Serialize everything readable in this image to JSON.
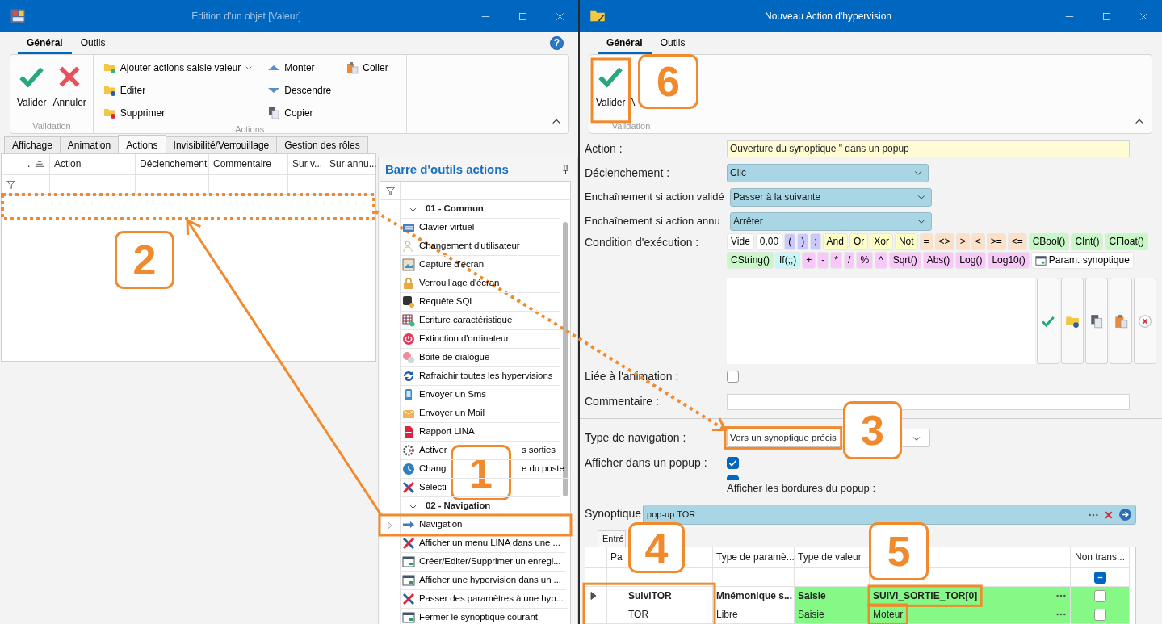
{
  "left_window": {
    "title": "Edition d'un objet [Valeur]",
    "active": false,
    "ribbon_tabs": [
      {
        "label": "Général",
        "selected": true
      },
      {
        "label": "Outils",
        "selected": false
      }
    ],
    "help": "?",
    "ribbon_groups": [
      {
        "kind": "large",
        "caption": "Validation",
        "buttons": [
          {
            "label": "Valider"
          },
          {
            "label": "Annuler"
          }
        ]
      },
      {
        "kind": "small",
        "caption": "Actions",
        "columns": [
          [
            {
              "label": "Ajouter actions saisie valeur",
              "dropdown": true
            },
            {
              "label": "Editer"
            },
            {
              "label": "Supprimer"
            }
          ],
          [
            {
              "label": "Monter"
            },
            {
              "label": "Descendre"
            },
            {
              "label": "Copier"
            }
          ],
          [
            {
              "label": "Coller"
            }
          ]
        ]
      }
    ],
    "tabs": [
      {
        "label": "Affichage",
        "selected": false
      },
      {
        "label": "Animation",
        "selected": false
      },
      {
        "label": "Actions",
        "selected": true
      },
      {
        "label": "Invisibilité/Verrouillage",
        "selected": false
      },
      {
        "label": "Gestion des rôles",
        "selected": false
      }
    ],
    "grid": {
      "columns": [
        {
          "label": ".",
          "sorted": true
        },
        {
          "label": "Action",
          "sorted": false
        },
        {
          "label": "Déclenchement",
          "sorted": false
        },
        {
          "label": "Commentaire",
          "sorted": false
        },
        {
          "label": "Sur v...",
          "sorted": false
        },
        {
          "label": "Sur annu...",
          "sorted": false
        }
      ]
    },
    "toolbox": {
      "title": "Barre d'outils actions",
      "groups": [
        {
          "label": "01 - Commun",
          "expanded": true,
          "children": [
            {
              "label": "Clavier virtuel",
              "selected": false
            },
            {
              "label": "Changement d'utilisateur",
              "selected": false
            },
            {
              "label": "Capture d'écran",
              "selected": false
            },
            {
              "label": "Verrouillage d'écran",
              "selected": false
            },
            {
              "label": "Requête SQL",
              "selected": false
            },
            {
              "label": "Ecriture caractéristique",
              "selected": false
            },
            {
              "label": "Extinction d'ordinateur",
              "selected": false
            },
            {
              "label": "Boite de dialogue",
              "selected": false
            },
            {
              "label": "Rafraichir toutes les hypervisions",
              "selected": false
            },
            {
              "label": "Envoyer un Sms",
              "selected": false
            },
            {
              "label": "Envoyer un Mail",
              "selected": false
            },
            {
              "label": "Rapport LINA",
              "selected": false
            },
            {
              "label": "Activer",
              "tail": "s sorties",
              "selected": false
            },
            {
              "label": "Chang",
              "tail": "e du poste",
              "selected": false
            },
            {
              "label": "Sélecti",
              "selected": false
            }
          ]
        },
        {
          "label": "02 - Navigation",
          "expanded": true,
          "children": [
            {
              "label": "Navigation",
              "selected": true
            },
            {
              "label": "Afficher un menu LINA dans une ...",
              "selected": false
            },
            {
              "label": "Créer/Editer/Supprimer un enregi...",
              "selected": false
            },
            {
              "label": "Afficher une hypervision dans un ...",
              "selected": false
            },
            {
              "label": "Passer des paramètres à une hyp...",
              "selected": false
            },
            {
              "label": "Fermer le synoptique courant",
              "selected": false
            }
          ]
        }
      ]
    }
  },
  "right_window": {
    "title": "Nouveau Action d'hypervision",
    "active": true,
    "ribbon_tabs": [
      {
        "label": "Général",
        "selected": true
      },
      {
        "label": "Outils",
        "selected": false
      }
    ],
    "ribbon_caption": "Validation",
    "ribbon_buttons": [
      {
        "label": "Valider"
      },
      {
        "label": "A"
      }
    ],
    "form": [
      {
        "label": "Action :",
        "kind": "text",
        "value": "Ouverture du synoptique \" dans un popup"
      },
      {
        "label": "Déclenchement :",
        "kind": "select",
        "value": "Clic"
      },
      {
        "label": "Enchaînement si action validé",
        "kind": "select",
        "value": "Passer à la suivante"
      },
      {
        "label": "Enchaînement si action annu",
        "kind": "select",
        "value": "Arrêter"
      },
      {
        "label": "Condition d'exécution :",
        "kind": "expression",
        "token_rows": [
          [
            {
              "label": "Vide",
              "color": "#ffffff"
            },
            {
              "label": "0,00",
              "color": "#ffffff"
            },
            {
              "label": "(",
              "color": "#c9c9fb"
            },
            {
              "label": ")",
              "color": "#c9c9fb"
            },
            {
              "label": ";",
              "color": "#c9c9fb"
            },
            {
              "label": "And",
              "color": "#fdfdc6"
            },
            {
              "label": "Or",
              "color": "#fdfdc6"
            },
            {
              "label": "Xor",
              "color": "#fdfdc6"
            },
            {
              "label": "Not",
              "color": "#fdfdc6"
            },
            {
              "label": "=",
              "color": "#fde0c8"
            },
            {
              "label": "<>",
              "color": "#fde0c8"
            },
            {
              "label": ">",
              "color": "#fde0c8"
            },
            {
              "label": "<",
              "color": "#fde0c8"
            },
            {
              "label": ">=",
              "color": "#fde0c8"
            },
            {
              "label": "<=",
              "color": "#fde0c8"
            },
            {
              "label": "CBool()",
              "color": "#c8f7c8"
            },
            {
              "label": "CInt()",
              "color": "#c8f7c8"
            },
            {
              "label": "CFloat()",
              "color": "#c8f7c8"
            }
          ],
          [
            {
              "label": "CString()",
              "color": "#c8f7c8"
            },
            {
              "label": "If(;;)",
              "color": "#c8f7f7"
            },
            {
              "label": "+",
              "color": "#f8c8f8"
            },
            {
              "label": "-",
              "color": "#f8c8f8"
            },
            {
              "label": "*",
              "color": "#f8c8f8"
            },
            {
              "label": "/",
              "color": "#f8c8f8"
            },
            {
              "label": "%",
              "color": "#f8c8f8"
            },
            {
              "label": "^",
              "color": "#f8c8f8"
            },
            {
              "label": "Sqrt()",
              "color": "#f8c8f8"
            },
            {
              "label": "Abs()",
              "color": "#f8c8f8"
            },
            {
              "label": "Log()",
              "color": "#f8c8f8"
            },
            {
              "label": "Log10()",
              "color": "#f8c8f8"
            },
            {
              "label": "Param. synoptique",
              "color": "#ffffff",
              "kind": "param"
            }
          ]
        ]
      },
      {
        "label": "Liée à l'animation :",
        "kind": "checkbox",
        "checked": false
      },
      {
        "label": "Commentaire :",
        "kind": "text"
      }
    ],
    "navigation_form": [
      {
        "label": "Type de navigation :",
        "kind": "select",
        "value": "Vers un synoptique précis"
      },
      {
        "label": "Afficher dans un popup :",
        "kind": "checkbox",
        "checked": true
      },
      {
        "label": "Afficher les bordures du popup :",
        "kind": "clipped_checkbox",
        "checked": true
      }
    ],
    "synoptique": {
      "label": "Synoptique",
      "value": "pop-up TOR"
    },
    "params_tab": "Entré",
    "params_grid": {
      "columns": [
        {
          "label": "Pa"
        },
        {
          "label": "Type de paramè..."
        },
        {
          "label": "Type de valeur"
        },
        {},
        {
          "label": "Non trans..."
        }
      ],
      "new_row": {
        "indeterminate": true
      },
      "rows": [
        {
          "selected": true,
          "name": "SuiviTOR",
          "param_type": "Mnémonique s...",
          "value_type": "Saisie",
          "value": "SUIVI_SORTIE_TOR[0]",
          "non_trans": false
        },
        {
          "selected": false,
          "name": "TOR",
          "param_type": "Libre",
          "value_type": "Saisie",
          "value": "Moteur",
          "non_trans": false
        }
      ]
    }
  },
  "annotations": {
    "steps": [
      {
        "label": "1"
      },
      {
        "label": "2"
      },
      {
        "label": "3"
      },
      {
        "label": "4"
      },
      {
        "label": "5"
      },
      {
        "label": "6"
      }
    ]
  }
}
